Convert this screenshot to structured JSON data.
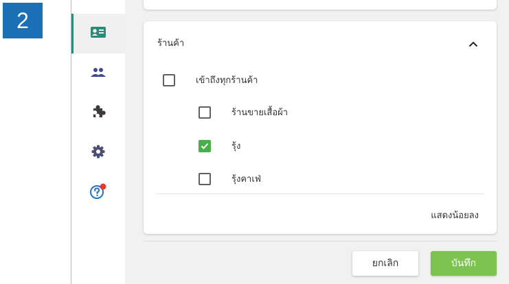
{
  "step_badge": "2",
  "sidebar": {
    "items": [
      {
        "icon": "contact-card-icon",
        "active": true
      },
      {
        "icon": "people-icon",
        "active": false
      },
      {
        "icon": "puzzle-icon",
        "active": false
      },
      {
        "icon": "gear-icon",
        "active": false
      },
      {
        "icon": "help-icon",
        "active": false,
        "notification_dot": true
      }
    ]
  },
  "stores_section": {
    "title": "ร้านค้า",
    "all_stores_label": "เข้าถึงทุกร้านค้า",
    "all_stores_checked": false,
    "stores": [
      {
        "label": "ร้านขายเสื้อผ้า",
        "checked": false
      },
      {
        "label": "รุ้ง",
        "checked": true
      },
      {
        "label": "รุ้งคาเฟ่",
        "checked": false
      }
    ],
    "show_less_label": "แสดงน้อยลง"
  },
  "footer": {
    "cancel_label": "ยกเลิก",
    "save_label": "บันทึก"
  },
  "colors": {
    "badge": "#1a6fb5",
    "active_indicator": "#2e8b78",
    "checked": "#47b04b",
    "save_button": "#7cc44f",
    "icon_default": "#3f4a8a",
    "notification": "#e53935"
  }
}
